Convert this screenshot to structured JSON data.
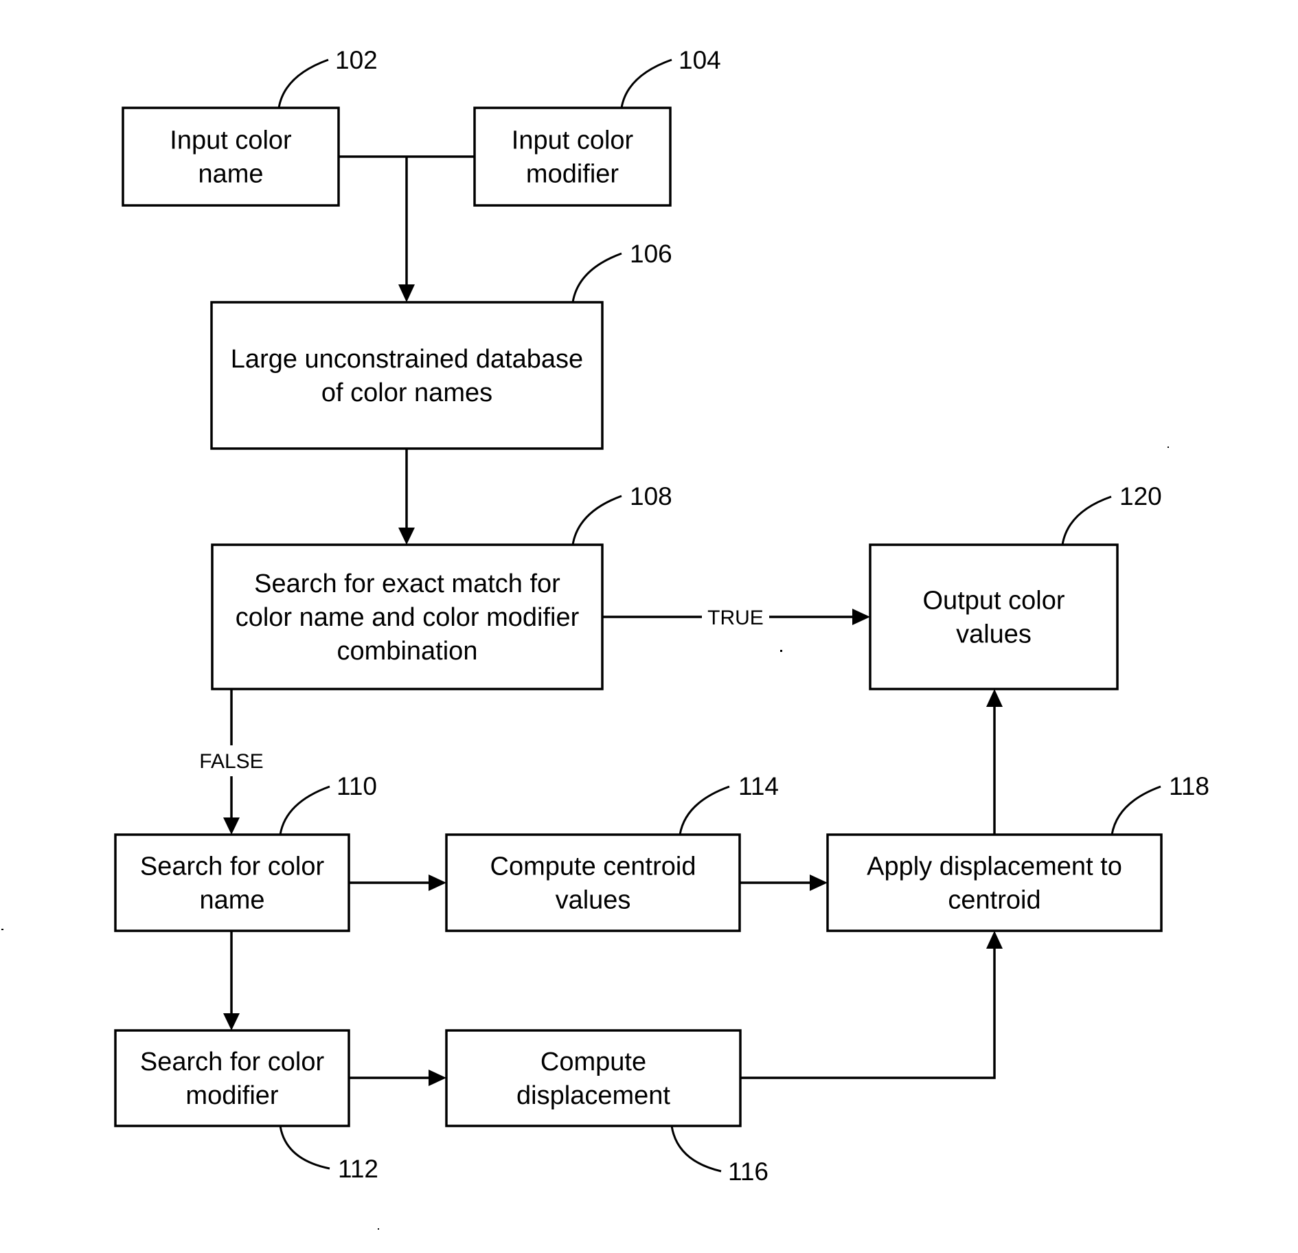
{
  "diagram": {
    "type": "flowchart",
    "nodes": [
      {
        "id": "102",
        "ref": "102",
        "lines": [
          "Input color",
          "name"
        ]
      },
      {
        "id": "104",
        "ref": "104",
        "lines": [
          "Input color",
          "modifier"
        ]
      },
      {
        "id": "106",
        "ref": "106",
        "lines": [
          "Large unconstrained database",
          "of color names"
        ]
      },
      {
        "id": "108",
        "ref": "108",
        "lines": [
          "Search for exact match for",
          "color name and color modifier",
          "combination"
        ]
      },
      {
        "id": "110",
        "ref": "110",
        "lines": [
          "Search for color",
          "name"
        ]
      },
      {
        "id": "112",
        "ref": "112",
        "lines": [
          "Search for color",
          "modifier"
        ]
      },
      {
        "id": "114",
        "ref": "114",
        "lines": [
          "Compute centroid",
          "values"
        ]
      },
      {
        "id": "116",
        "ref": "116",
        "lines": [
          "Compute",
          "displacement"
        ]
      },
      {
        "id": "118",
        "ref": "118",
        "lines": [
          "Apply displacement to",
          "centroid"
        ]
      },
      {
        "id": "120",
        "ref": "120",
        "lines": [
          "Output color",
          "values"
        ]
      }
    ],
    "edges": [
      {
        "from": "102",
        "to": "106",
        "label": ""
      },
      {
        "from": "104",
        "to": "106",
        "label": ""
      },
      {
        "from": "106",
        "to": "108",
        "label": ""
      },
      {
        "from": "108",
        "to": "120",
        "label": "TRUE"
      },
      {
        "from": "108",
        "to": "110",
        "label": "FALSE"
      },
      {
        "from": "110",
        "to": "114",
        "label": ""
      },
      {
        "from": "110",
        "to": "112",
        "label": ""
      },
      {
        "from": "112",
        "to": "116",
        "label": ""
      },
      {
        "from": "114",
        "to": "118",
        "label": ""
      },
      {
        "from": "116",
        "to": "118",
        "label": ""
      },
      {
        "from": "118",
        "to": "120",
        "label": ""
      }
    ]
  }
}
